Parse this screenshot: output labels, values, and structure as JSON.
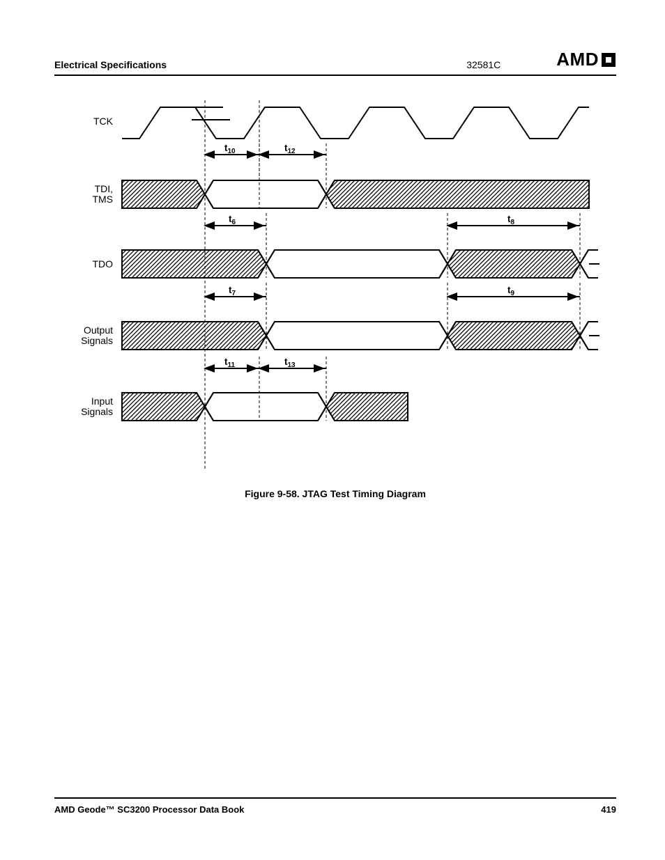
{
  "header": {
    "section": "Electrical Specifications",
    "docnum": "32581C",
    "logo": "AMD"
  },
  "signals": {
    "tck": "TCK",
    "tdi_tms_1": "TDI,",
    "tdi_tms_2": "TMS",
    "tdo": "TDO",
    "output_1": "Output",
    "output_2": "Signals",
    "input_1": "Input",
    "input_2": "Signals"
  },
  "timing": {
    "t6_base": "t",
    "t6_sub": "6",
    "t7_base": "t",
    "t7_sub": "7",
    "t8_base": "t",
    "t8_sub": "8",
    "t9_base": "t",
    "t9_sub": "9",
    "t10_base": "t",
    "t10_sub": "10",
    "t11_base": "t",
    "t11_sub": "11",
    "t12_base": "t",
    "t12_sub": "12",
    "t13_base": "t",
    "t13_sub": "13"
  },
  "caption": "Figure 9-58.  JTAG Test Timing Diagram",
  "footer": {
    "book": "AMD Geode™ SC3200 Processor Data Book",
    "page": "419"
  }
}
